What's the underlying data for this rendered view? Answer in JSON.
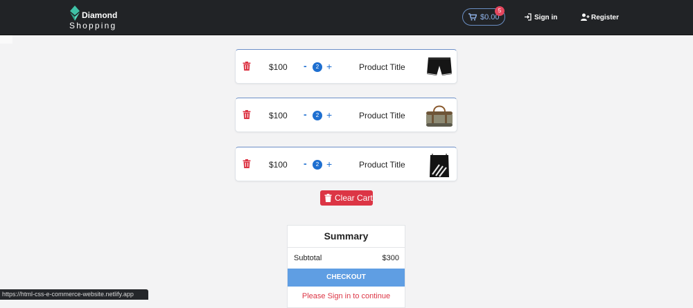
{
  "brand": {
    "title": "Diamond",
    "subtitle": "Shopping"
  },
  "header": {
    "cart_total": "$0.00",
    "cart_count": "5",
    "signin_label": "Sign in",
    "register_label": "Register"
  },
  "cart": {
    "items": [
      {
        "price": "$100",
        "minus": "-",
        "qty": "2",
        "plus": "+",
        "title": "Product Title",
        "image": "shorts"
      },
      {
        "price": "$100",
        "minus": "-",
        "qty": "2",
        "plus": "+",
        "title": "Product Title",
        "image": "duffel-bag"
      },
      {
        "price": "$100",
        "minus": "-",
        "qty": "2",
        "plus": "+",
        "title": "Product Title",
        "image": "drawstring-backpack"
      }
    ],
    "clear_label": "Clear Cart"
  },
  "summary": {
    "title": "Summary",
    "subtotal_label": "Subtotal",
    "subtotal_value": "$300",
    "checkout_label": "CHECKOUT",
    "signin_note": "Please Sign in to continue"
  },
  "status_bar": {
    "url": "https://html-css-e-commerce-website.netlify.app"
  },
  "colors": {
    "navbar": "#212326",
    "accent_blue": "#1e6fd0",
    "danger_red": "#dc3545",
    "checkout_blue": "#5f9ee3",
    "background": "#f3f3f4"
  }
}
